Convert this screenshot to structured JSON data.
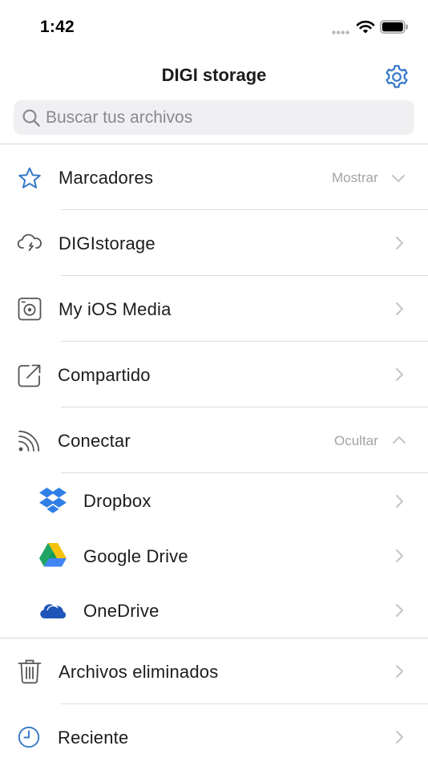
{
  "status_bar": {
    "time": "1:42"
  },
  "header": {
    "title": "DIGI storage"
  },
  "search": {
    "placeholder": "Buscar tus archivos"
  },
  "menu": {
    "bookmarks": {
      "label": "Marcadores",
      "toggle": "Mostrar"
    },
    "digistorage": {
      "label": "DIGIstorage"
    },
    "ios_media": {
      "label": "My iOS Media"
    },
    "shared": {
      "label": "Compartido"
    },
    "connect": {
      "label": "Conectar",
      "toggle": "Ocultar"
    },
    "connections": [
      {
        "label": "Dropbox"
      },
      {
        "label": "Google Drive"
      },
      {
        "label": "OneDrive"
      }
    ],
    "deleted": {
      "label": "Archivos eliminados"
    },
    "recent": {
      "label": "Reciente"
    }
  },
  "colors": {
    "accent": "#3478c8",
    "icon_gray": "#555558",
    "chevron": "#c4c4c8",
    "dropbox": "#2f7fe6",
    "onedrive": "#1f55b8"
  },
  "icons": {
    "bookmarks": "star-icon",
    "digistorage": "cloud-sync-icon",
    "ios_media": "media-icon",
    "shared": "share-icon",
    "connect": "rss-icon",
    "deleted": "trash-icon",
    "recent": "clock-icon"
  }
}
